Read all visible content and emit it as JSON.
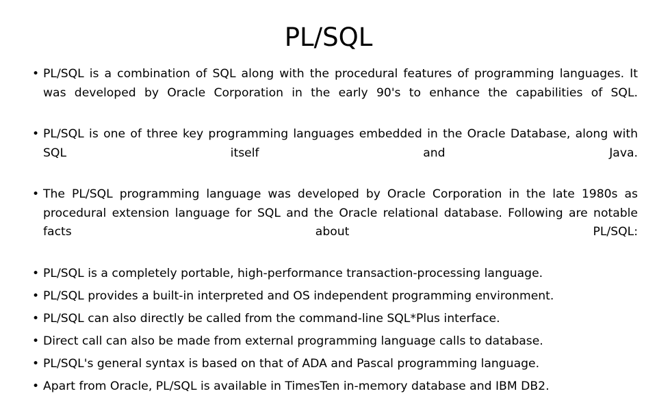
{
  "slide": {
    "title": "PL/SQL",
    "bullet_marker": "•",
    "bullets": [
      {
        "text": "PL/SQL is a combination of SQL along with the procedural features of programming languages. It was developed by Oracle Corporation in the early 90's to enhance the capabilities of SQL.",
        "justified": true
      },
      {
        "text": "PL/SQL is one of three key programming languages embedded in the Oracle Database, along with SQL itself and Java.",
        "justified": true
      },
      {
        "text": "The PL/SQL programming language was developed by Oracle Corporation in the late 1980s as procedural extension language for SQL and the Oracle relational database. Following are notable facts about PL/SQL:",
        "justified": true
      },
      {
        "text": "PL/SQL is a completely portable, high-performance transaction-processing language.",
        "justified": false
      },
      {
        "text": "PL/SQL provides a built-in interpreted and OS independent programming environment.",
        "justified": false
      },
      {
        "text": "PL/SQL can also directly be called from the command-line SQL*Plus interface.",
        "justified": false
      },
      {
        "text": "Direct call can also be made from external programming language calls to database.",
        "justified": false
      },
      {
        "text": "PL/SQL's general syntax is based on that of ADA and Pascal programming language.",
        "justified": false
      },
      {
        "text": "Apart from Oracle, PL/SQL is available in TimesTen in-memory database and IBM DB2.",
        "justified": false
      }
    ],
    "colors": {
      "background": "#ffffff",
      "text": "#000000"
    }
  }
}
